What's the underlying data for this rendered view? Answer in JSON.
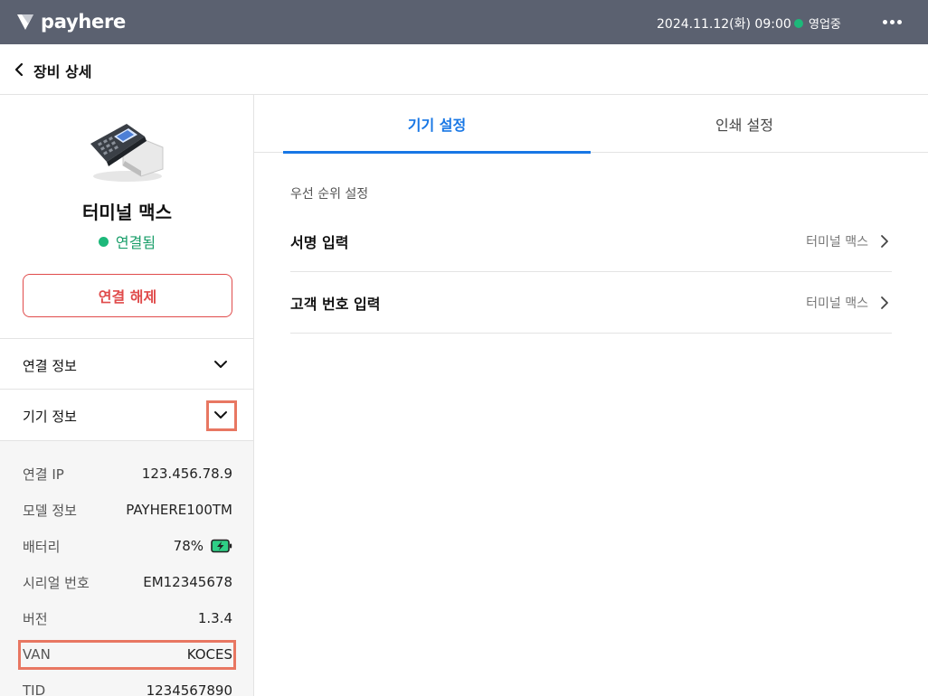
{
  "topbar": {
    "brand": "payhere",
    "datetime": "2024.11.12(화) 09:00",
    "status": "영업중",
    "status_color": "#1db87a",
    "more_icon": "more-horizontal-icon"
  },
  "header": {
    "back_icon": "chevron-left-icon",
    "title": "장비 상세"
  },
  "sidebar": {
    "device_name": "터미널 맥스",
    "connection_status": "연결됨",
    "disconnect_label": "연결 해제",
    "sections": [
      {
        "label": "연결 정보",
        "expanded": false
      },
      {
        "label": "기기 정보",
        "expanded": true
      }
    ],
    "device_info": [
      {
        "key": "연결 IP",
        "value": "123.456.78.9"
      },
      {
        "key": "모델 정보",
        "value": "PAYHERE100TM"
      },
      {
        "key": "배터리",
        "value": "78%"
      },
      {
        "key": "시리얼 번호",
        "value": "EM12345678"
      },
      {
        "key": "버전",
        "value": "1.3.4"
      },
      {
        "key": "VAN",
        "value": "KOCES"
      },
      {
        "key": "TID",
        "value": "1234567890"
      }
    ]
  },
  "main": {
    "tabs": [
      {
        "label": "기기 설정",
        "active": true
      },
      {
        "label": "인쇄 설정",
        "active": false
      }
    ],
    "section_title": "우선 순위 설정",
    "settings": [
      {
        "label": "서명 입력",
        "value": "터미널 맥스"
      },
      {
        "label": "고객 번호 입력",
        "value": "터미널 맥스"
      }
    ]
  },
  "colors": {
    "accent": "#1877e5",
    "danger": "#e04b4b",
    "connected": "#1db87a",
    "highlight": "#e87762",
    "topbar": "#5b6170"
  }
}
